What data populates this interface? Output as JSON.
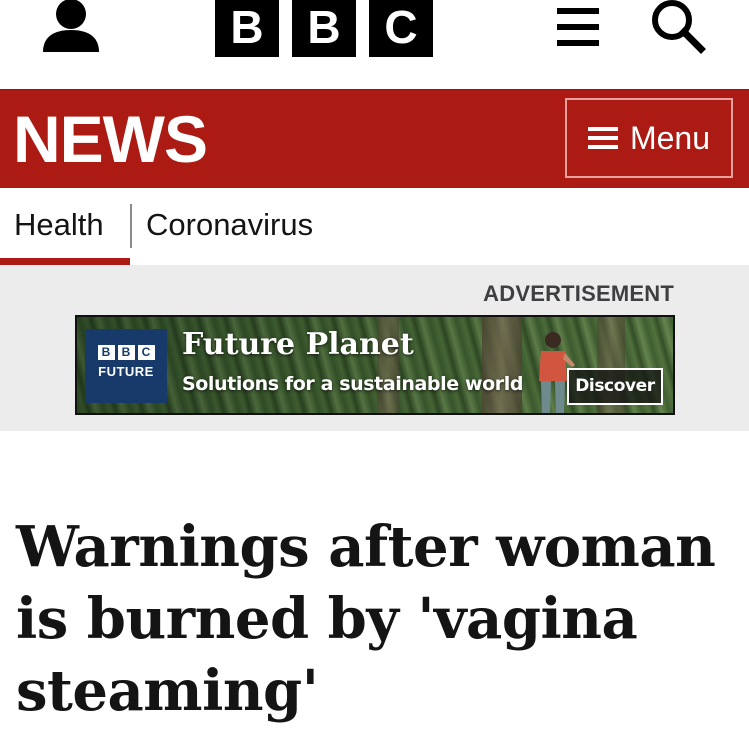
{
  "masthead": {
    "brand_letters": [
      "B",
      "B",
      "C"
    ],
    "icons": {
      "account": "account-icon",
      "menu": "hamburger-icon",
      "search": "search-icon"
    }
  },
  "news_bar": {
    "title": "NEWS",
    "menu_label": "Menu",
    "background_color": "#ab1b14"
  },
  "section_nav": {
    "items": [
      {
        "label": "Health",
        "active": true
      },
      {
        "label": "Coronavirus",
        "active": false
      }
    ],
    "active_color": "#b80000"
  },
  "advertisement": {
    "label": "ADVERTISEMENT",
    "banner": {
      "logo_letters": [
        "B",
        "B",
        "C"
      ],
      "logo_subtitle": "FUTURE",
      "headline": "Future Planet",
      "tagline": "Solutions for a sustainable world",
      "cta": "Discover"
    }
  },
  "article": {
    "headline": "Warnings after woman is burned by 'vagina steaming'"
  }
}
